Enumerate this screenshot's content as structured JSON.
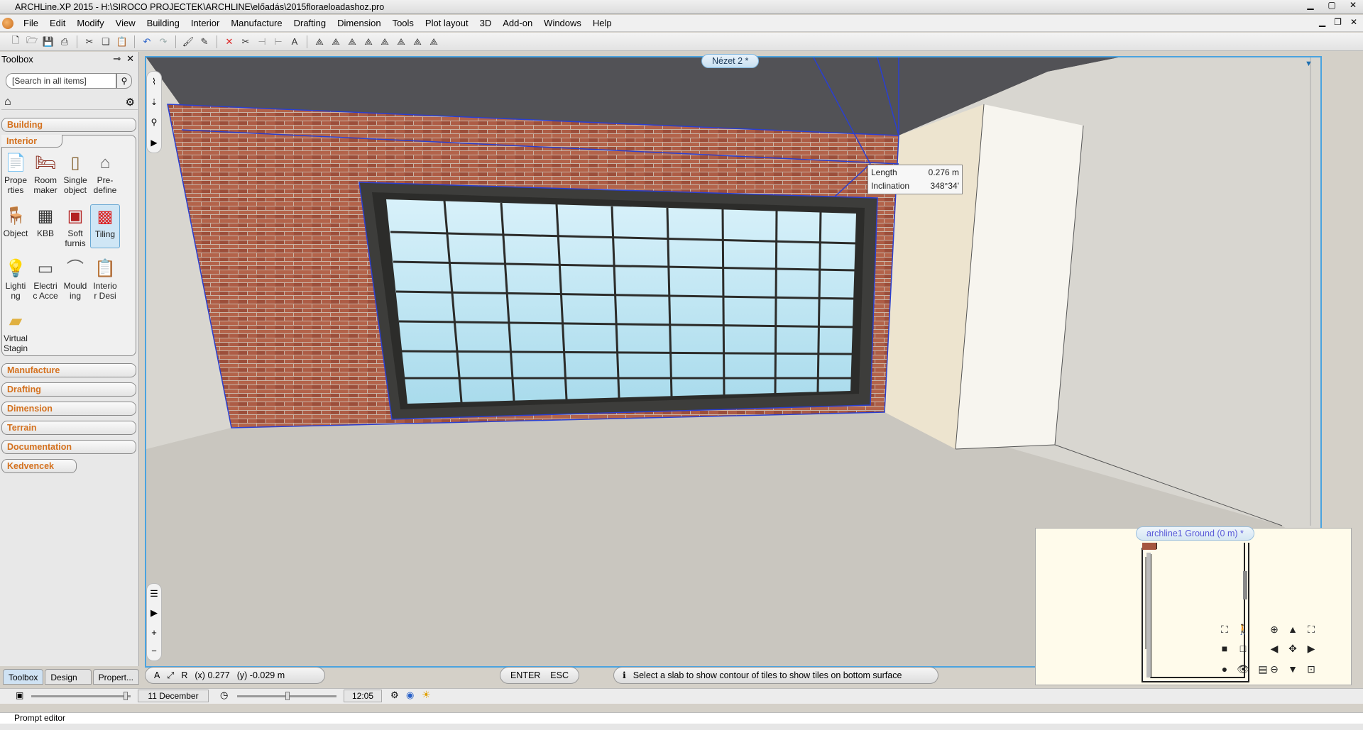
{
  "window": {
    "title": "ARCHLine.XP 2015 - H:\\SIROCO PROJECTEK\\ARCHLINE\\előadás\\2015floraeloadashoz.pro"
  },
  "menu": [
    "File",
    "Edit",
    "Modify",
    "View",
    "Building",
    "Interior",
    "Manufacture",
    "Drafting",
    "Dimension",
    "Tools",
    "Plot layout",
    "3D",
    "Add-on",
    "Windows",
    "Help"
  ],
  "toolbox": {
    "title": "Toolbox",
    "search_placeholder": "[Search in all items]",
    "categories": {
      "building": "Building",
      "interior": "Interior",
      "manufacture": "Manufacture",
      "drafting": "Drafting",
      "dimension": "Dimension",
      "terrain": "Terrain",
      "documentation": "Documentation",
      "kedvencek": "Kedvencek"
    },
    "tools": {
      "properties": "Prope\nrties",
      "room_maker": "Room\nmaker",
      "single_object": "Single\nobject",
      "predefine": "Pre-\ndefine",
      "object": "Object",
      "kbb": "KBB",
      "soft_furnis": "Soft\nfurnis",
      "tiling": "Tiling",
      "lighting": "Lighti\nng",
      "electric": "Electri\nc Acce",
      "moulding": "Mould\ning",
      "interior_desi": "Interio\nr Desi",
      "virtual_staging": "Virtual\nStagin"
    },
    "bottom_tabs": [
      "Toolbox",
      "Design ...",
      "Propert..."
    ]
  },
  "viewport": {
    "tab": "Nézet 2 *",
    "tooltip": {
      "length_label": "Length",
      "length_value": "0.276 m",
      "incl_label": "Inclination",
      "incl_value": "348°34'"
    },
    "colors": {
      "brick": "#a5553f",
      "glass": "#bfe6f3",
      "floor": "#c9c6bf",
      "ceiling": "#525256",
      "frame": "#3d3d3b",
      "selection": "#2a3fd0"
    }
  },
  "minimap": {
    "tab": "archline1 Ground (0 m) *"
  },
  "command": {
    "x_label": "(x) 0.277",
    "y_label": "(y) -0.029 m",
    "enter": "ENTER",
    "esc": "ESC",
    "message": "Select a slab to show contour of tiles to show tiles on bottom surface"
  },
  "status": {
    "date": "11 December",
    "time": "12:05"
  },
  "prompt": "Prompt editor"
}
